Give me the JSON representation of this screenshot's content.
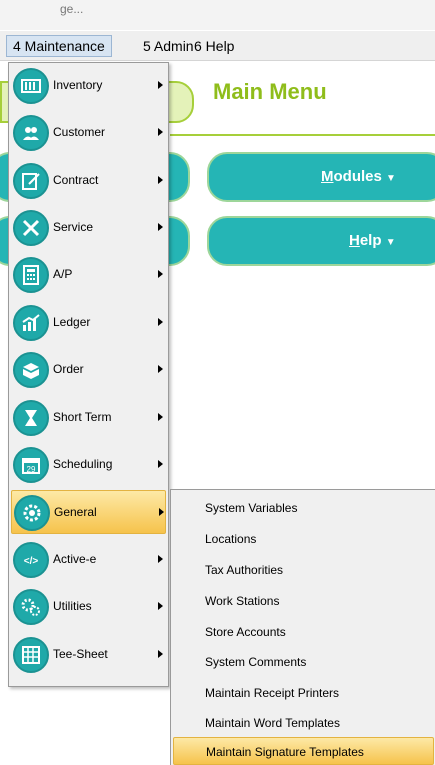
{
  "window": {
    "title_fragment": "ge..."
  },
  "menubar": {
    "items": [
      {
        "label": "4 Maintenance"
      },
      {
        "label": "5 Admin"
      },
      {
        "label": "6 Help"
      }
    ]
  },
  "main": {
    "title": "Main Menu",
    "modules_button": {
      "label": "Modules",
      "mnemonic": "M",
      "rest": "odules",
      "caret": "▼"
    },
    "help_button": {
      "label": "Help",
      "mnemonic": "H",
      "rest": "elp",
      "caret": "▼"
    }
  },
  "maintenance_menu": {
    "items": [
      {
        "label": "Inventory",
        "icon": "inventory-icon"
      },
      {
        "label": "Customer",
        "icon": "customer-icon"
      },
      {
        "label": "Contract",
        "icon": "contract-icon"
      },
      {
        "label": "Service",
        "icon": "service-icon"
      },
      {
        "label": "A/P",
        "icon": "calculator-icon"
      },
      {
        "label": "Ledger",
        "icon": "ledger-icon"
      },
      {
        "label": "Order",
        "icon": "order-icon"
      },
      {
        "label": "Short Term",
        "icon": "hourglass-icon"
      },
      {
        "label": "Scheduling",
        "icon": "calendar-icon",
        "icon_text": "29"
      },
      {
        "label": "General",
        "icon": "gear-icon",
        "highlighted": true
      },
      {
        "label": "Active-e",
        "icon": "code-icon",
        "icon_text": "</>"
      },
      {
        "label": "Utilities",
        "icon": "utilities-icon"
      },
      {
        "label": "Tee-Sheet",
        "icon": "tee-sheet-icon"
      }
    ]
  },
  "general_submenu": {
    "items": [
      {
        "label": "System Variables"
      },
      {
        "label": "Locations"
      },
      {
        "label": "Tax Authorities"
      },
      {
        "label": "Work Stations"
      },
      {
        "label": "Store Accounts"
      },
      {
        "label": "System Comments"
      },
      {
        "label": "Maintain Receipt Printers"
      },
      {
        "label": "Maintain Word Templates"
      },
      {
        "label": "Maintain Signature Templates",
        "highlighted": true
      }
    ]
  },
  "colors": {
    "accent_teal": "#25b5b5",
    "accent_green": "#a6cf3a",
    "menu_highlight": "#f6c34c"
  }
}
